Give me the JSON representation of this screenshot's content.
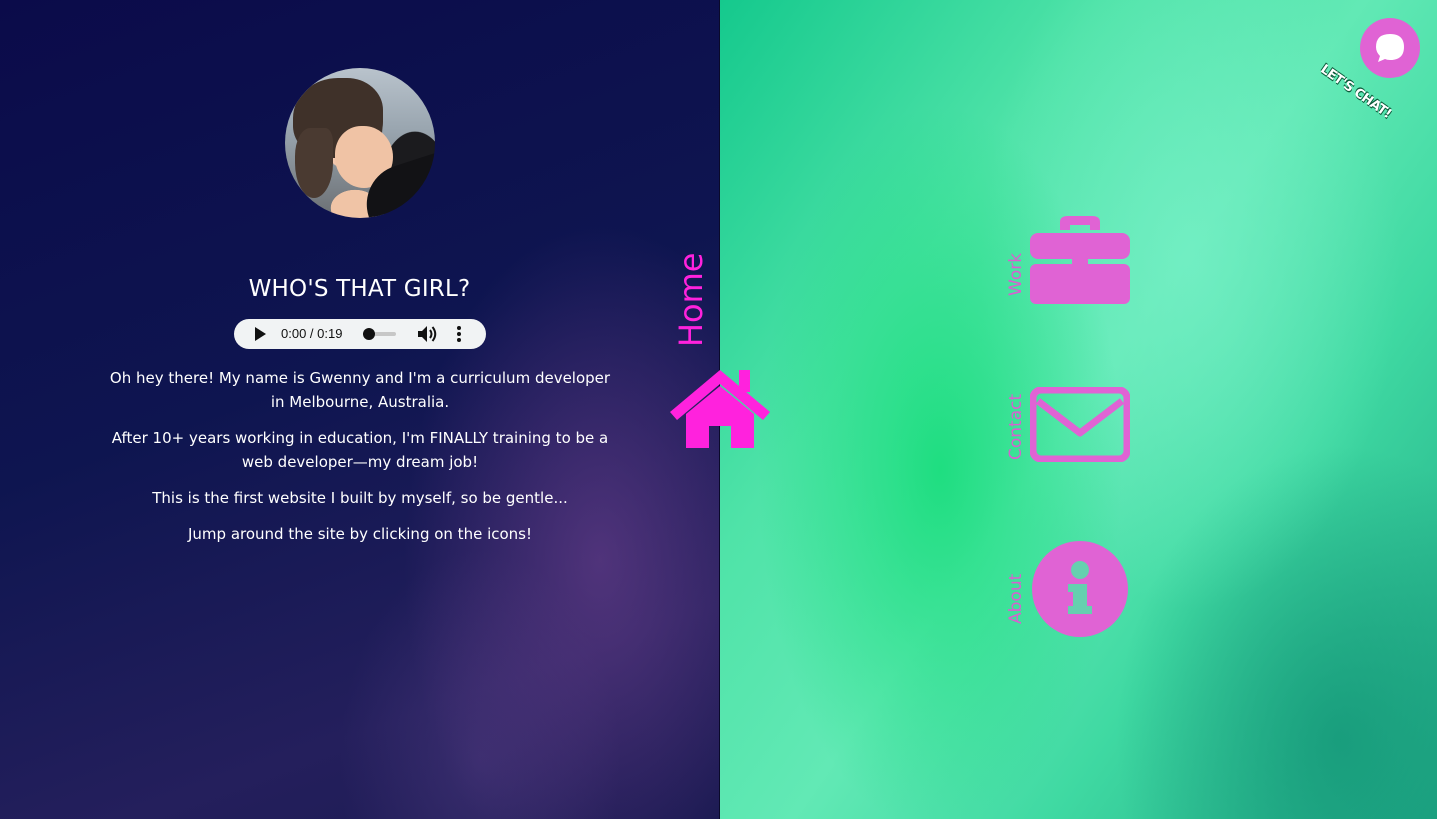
{
  "about": {
    "heading": "WHO'S THAT GIRL?",
    "audio": {
      "time": "0:00 / 0:19",
      "progress": 0
    },
    "paragraphs": [
      "Oh hey there! My name is Gwenny and I'm a curriculum developer in Melbourne, Australia.",
      "After 10+ years working in education, I'm FINALLY training to be a web developer—my dream job!",
      "This is the first website I built by myself, so be gentle...",
      "Jump around the site by clicking on the icons!"
    ]
  },
  "home": {
    "label": "Home",
    "icon": "home-icon"
  },
  "nav": {
    "items": [
      {
        "label": "Work",
        "icon": "briefcase-icon"
      },
      {
        "label": "Contact",
        "icon": "envelope-icon"
      },
      {
        "label": "About",
        "icon": "info-icon"
      }
    ]
  },
  "chat": {
    "label": "LET'S CHAT!",
    "icon": "chat-bubble-icon"
  },
  "colors": {
    "accent": "#e063d4",
    "home_accent": "#ff22dd",
    "left_bg": "#0e1550",
    "right_bg": "#4fe3a8"
  }
}
